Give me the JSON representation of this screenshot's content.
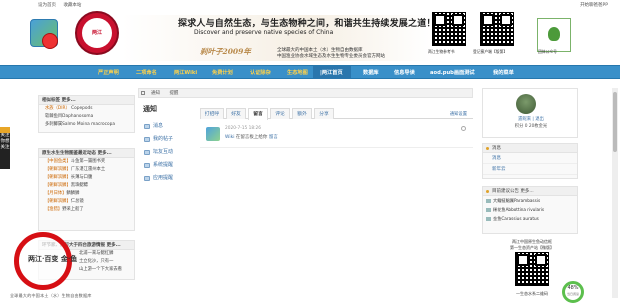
{
  "topbar": {
    "left_links": [
      "设为首页",
      "收藏本站"
    ],
    "right_link": "开始聊爸爸PP"
  },
  "header": {
    "slogan_cn": "探求人与自然生态，与生态物种之间，和谐共生持续发展之道！",
    "slogan_en1": "Discover and preserve native species of China",
    "brand_art": "刹叶子2009年",
    "desc1": "全球最大的中国本土（水）生物自由数据库",
    "desc2": "中国渔业协会水域生态及水生生物专业委员会官方网站",
    "qr_captions": [
      "两江生物参考书",
      "登记蜜户端【版第】",
      "团体公众号"
    ]
  },
  "nav": {
    "items": [
      "严正声明",
      "二项命名",
      "两江Wiki",
      "免费计划",
      "认证除杂",
      "生态地图",
      "|两江首页",
      "数据库",
      "信息导读",
      "aod.pub画面测试",
      "我的菜单"
    ]
  },
  "left_rail": {
    "label": "关注你想关注"
  },
  "left_panels": {
    "tags": {
      "title": "相似标签 更多...",
      "rows": [
        {
          "tag": "水族（DIR）",
          "text": "Copepods"
        },
        {
          "tag": "",
          "text": "软棘鱼目Daphanosoma"
        },
        {
          "tag": "",
          "text": "多刺鲫属Salmo Moina macrocopa"
        }
      ]
    },
    "threads": {
      "title": "原生水生生物图鉴最近动态 更多...",
      "rows": [
        {
          "tag": "【中国鱼类】",
          "text": "斗鱼第一篇图书奖"
        },
        {
          "tag": "【朝鲜滨鳞】",
          "text": "广东湛江雷州本土"
        },
        {
          "tag": "【朝鲜滨鳞】",
          "text": "长薄与口腹"
        },
        {
          "tag": "【朝鲜滨鳞】",
          "text": "黑珠鳃鳔"
        },
        {
          "tag": "【月日体】",
          "text": "鳞鳞鳞"
        },
        {
          "tag": "【朝鲜滨鳞】",
          "text": "仁总镜"
        },
        {
          "tag": "【渔猎】",
          "text": "野采上船了"
        }
      ]
    },
    "stories": {
      "title": "环节家、旅行大于四台旅游情报 更多...",
      "rows": [
        {
          "tag": "",
          "text": "北浦一来与鳃红鳞"
        },
        {
          "tag": "",
          "text": "土立化沙，只有一"
        },
        {
          "tag": "",
          "text": "山上游一个下大家去看"
        }
      ]
    }
  },
  "stamp": {
    "text": "两江·百变 金·鱼",
    "bottom_caption": "全球最大的中国本土（水）生物自由数据库"
  },
  "main": {
    "breadcrumb": [
      "通知",
      "提醒"
    ],
    "title": "通知",
    "menu": [
      "消息",
      "我的帖子",
      "坛友互动",
      "系统提醒",
      "应用提醒"
    ],
    "tabs": [
      "打招呼",
      "好友",
      "留言",
      "评论",
      "额外",
      "分享"
    ],
    "active_tab": "留言",
    "tab_right": "通知设置",
    "feed": {
      "time": "2020-7-15 18:26",
      "actor": "Wiki",
      "action": "在留言板上给你",
      "link": "留言"
    }
  },
  "right": {
    "profile": {
      "name": "遗昵来  |  退出",
      "stats": "积分 0  20枚金光"
    },
    "messages": {
      "title": "消息",
      "items": [
        "消息",
        "新年云"
      ]
    },
    "picks": {
      "title": "目前建议公告 更多...",
      "rows": [
        "大鳍鲢鲳属Parambassis",
        "稀花鱼Abbottina rivularis",
        "金鱼Carassius auratus"
      ]
    },
    "bottom_qr": {
      "cap1": "两江中国原生鱼动信框",
      "cap2": "第一生态资产站【微版】",
      "cap3": "一生态水系二维码"
    }
  },
  "percent_widget": {
    "value": "48%",
    "sub": "当日阅读"
  },
  "colors": {
    "nav_bg": "#3a90c9",
    "nav_text": "#ffd24a",
    "accent_red": "#d60f14",
    "link": "#3a6fa5"
  }
}
